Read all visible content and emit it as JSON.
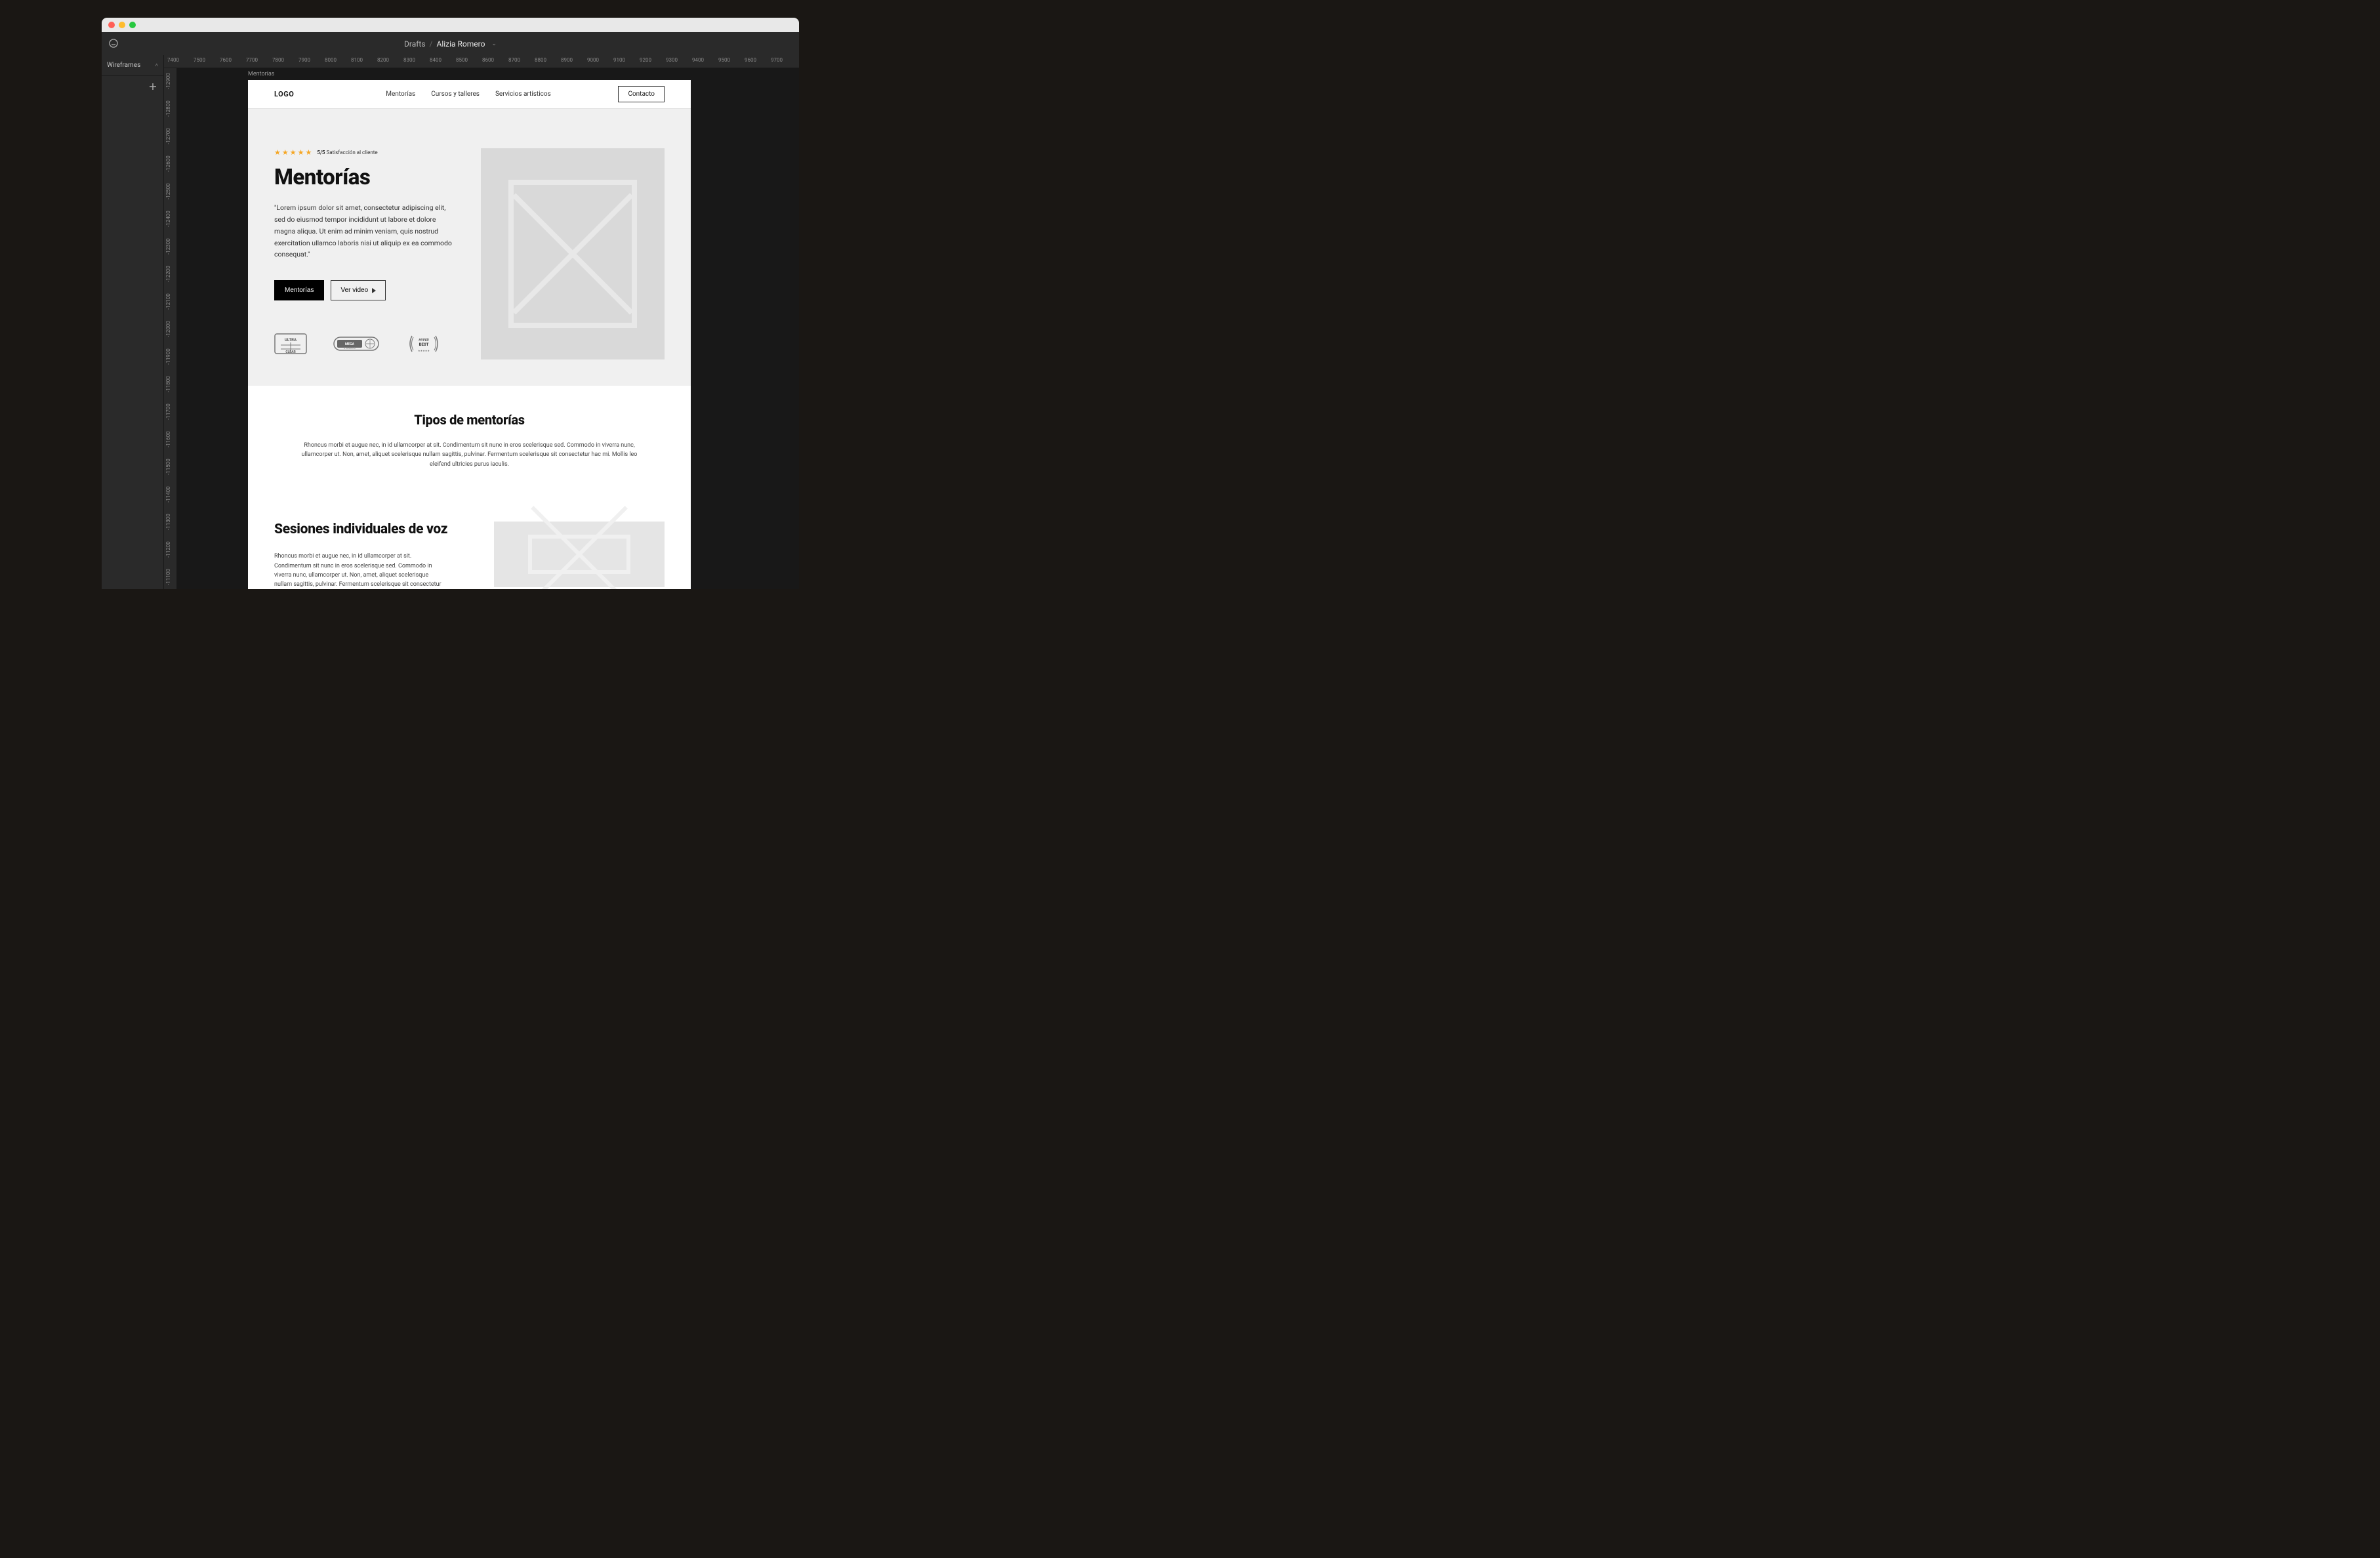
{
  "breadcrumb": {
    "parent": "Drafts",
    "current": "Alizia Romero"
  },
  "leftpanel": {
    "title": "Wireframes"
  },
  "ruler_h": [
    "7400",
    "7500",
    "7600",
    "7700",
    "7800",
    "7900",
    "8000",
    "8100",
    "8200",
    "8300",
    "8400",
    "8500",
    "8600",
    "8700",
    "8800",
    "8900",
    "9000",
    "9100",
    "9200",
    "9300",
    "9400",
    "9500",
    "9600",
    "9700"
  ],
  "ruler_v": [
    "-12900",
    "-12800",
    "-12700",
    "-12600",
    "-12500",
    "-12400",
    "-12300",
    "-12200",
    "-12100",
    "-12000",
    "-11900",
    "-11800",
    "-11700",
    "-11600",
    "-11500",
    "-11400",
    "-11300",
    "-11200",
    "-11100"
  ],
  "frame_label": "Mentorías",
  "artboard": {
    "logo": "LOGO",
    "nav": [
      "Mentorías",
      "Cursos y talleres",
      "Servicios artísticos"
    ],
    "contact": "Contacto",
    "hero": {
      "rating": "5/5",
      "rating_label": "Satisfacción al cliente",
      "title": "Mentorías",
      "lead": "\"Lorem ipsum dolor sit amet, consectetur adipiscing elit, sed do eiusmod tempor incididunt ut labore et dolore magna aliqua. Ut enim ad minim veniam, quis nostrud exercitation ullamco laboris nisi ut aliquip ex ea commodo consequat.\"",
      "btn_primary": "Mentorías",
      "btn_outline": "Ver video",
      "badges": [
        "ULTRA CLEAR",
        "MEGA STANDARD",
        "HYPER BEST"
      ]
    },
    "section2": {
      "title": "Tipos de mentorías",
      "body": "Rhoncus morbi et augue nec, in id ullamcorper at sit. Condimentum sit nunc in eros scelerisque sed. Commodo in viverra nunc, ullamcorper ut. Non, amet, aliquet scelerisque nullam sagittis, pulvinar. Fermentum scelerisque sit consectetur hac mi. Mollis leo eleifend ultricies purus iaculis."
    },
    "section3": {
      "title": "Sesiones individuales de voz",
      "body": "Rhoncus morbi et augue nec, in id ullamcorper at sit. Condimentum sit nunc in eros scelerisque sed. Commodo in viverra nunc, ullamcorper ut. Non, amet, aliquet scelerisque nullam sagittis, pulvinar. Fermentum scelerisque sit consectetur hac mi. Mollis leo"
    }
  }
}
